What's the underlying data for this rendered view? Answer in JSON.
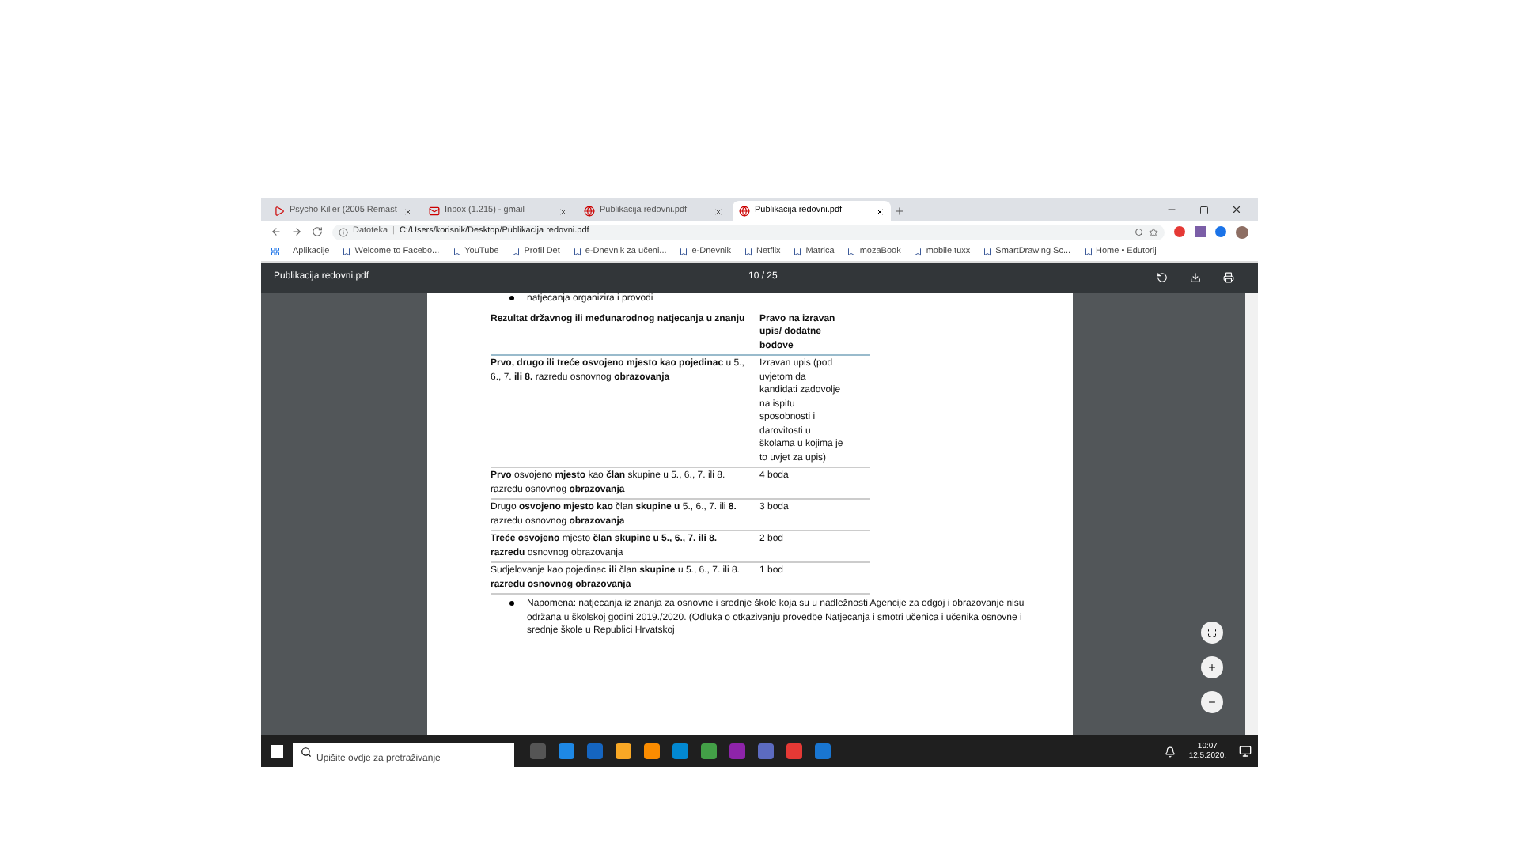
{
  "tabs": [
    {
      "title": "Psycho Killer (2005 Remast",
      "selected": false,
      "kind": "video"
    },
    {
      "title": "Inbox (1.215) - gmail",
      "selected": false,
      "kind": "mail"
    },
    {
      "title": "Publikacija redovni.pdf",
      "selected": false,
      "kind": "web"
    },
    {
      "title": "Publikacija redovni.pdf",
      "selected": true,
      "kind": "web"
    }
  ],
  "address": {
    "label": "Datoteka",
    "separator": "|",
    "url": "C:/Users/korisnik/Desktop/Publikacija redovni.pdf"
  },
  "bookmarks": [
    "Aplikacije",
    "Welcome to Facebo...",
    "YouTube",
    "Profil Det",
    "e-Dnevnik za učeni...",
    "e-Dnevnik",
    "Netflix",
    "Matrica",
    "mozaBook",
    "mobile.tuxx",
    "SmartDrawing Sc...",
    "Home • Edutorij"
  ],
  "pdf_toolbar": {
    "title": "Publikacija redovni.pdf",
    "page": "10 / 25"
  },
  "document": {
    "top_bullet": "natjecanja organizira i provodi",
    "table": {
      "columns": [
        "Rezultat državnog ili međunarodnog natjecanja u znanju",
        "Pravo na izravan upis/ dodatne bodove"
      ],
      "rows": [
        {
          "result": "**Prvo, drugo ili treće osvojeno mjesto kao pojedinac** u 5., 6., 7. **ili 8.** razredu osnovnog **obrazovanja**",
          "reward": "Izravan upis (pod uvjetom da kandidati zadovolje na ispitu sposobnosti i darovitosti u školama u kojima je to uvjet za upis)"
        },
        {
          "result": "**Prvo** osvojeno **mjesto** kao **član** skupine u 5., 6., 7. ili 8. razredu osnovnog **obrazovanja**",
          "reward": "4 boda"
        },
        {
          "result": "Drugo **osvojeno mjesto kao** član **skupine u** 5., 6., 7. ili **8.** razredu osnovnog **obrazovanja**",
          "reward": "3 boda"
        },
        {
          "result": "**Treće osvojeno** mjesto **član skupine u 5., 6., 7. ili 8. razredu** osnovnog obrazovanja",
          "reward": "2 bod"
        },
        {
          "result": "Sudjelovanje kao pojedinac **ili** član **skupine** u 5., 6., 7. ili 8. **razredu osnovnog obrazovanja**",
          "reward": "1 bod"
        }
      ]
    },
    "note": "Napomena: natjecanja iz znanja za osnovne i srednje škole koja su u nadležnosti Agencije za odgoj i obrazovanje nisu održana u školskoj godini 2019./2020. (Odluka o otkazivanju provedbe Natjecanja i smotri učenica i učenika osnovne i srednje škole u Republici Hrvatskoj"
  },
  "taskbar": {
    "search_placeholder": "Upišite ovdje za pretraživanje",
    "time": "10:07",
    "date": "12.5.2020."
  }
}
